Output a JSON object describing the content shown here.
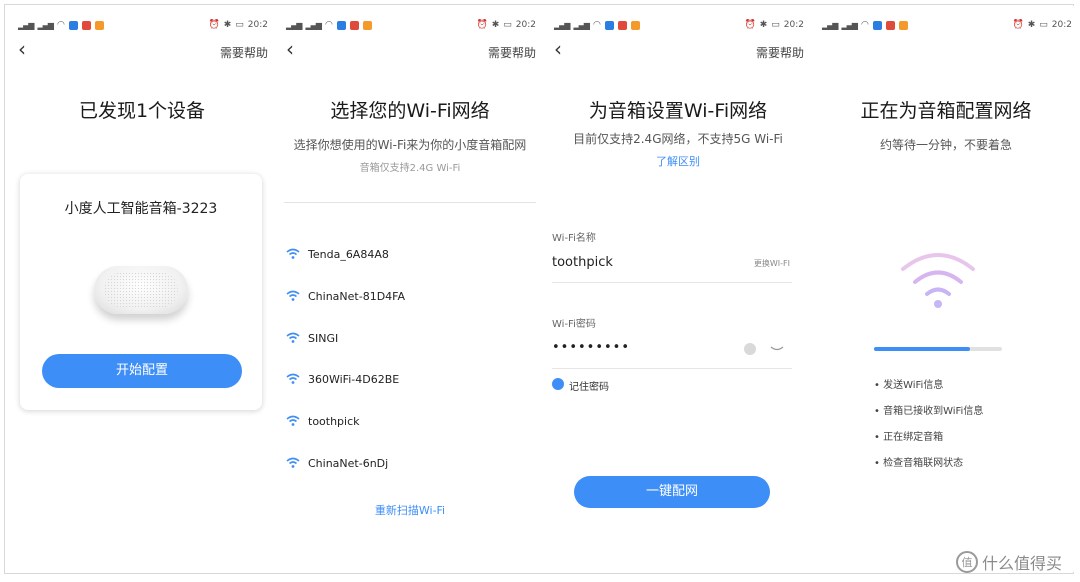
{
  "status_bar": {
    "time": "20:2",
    "left_icons": [
      "signal-icon",
      "signal-icon",
      "wifi-icon",
      "app-icon",
      "app-icon",
      "app-icon"
    ],
    "right_icons": [
      "alarm-icon",
      "bluetooth-icon",
      "battery-icon"
    ]
  },
  "colors": {
    "accent": "#3e8ef7",
    "divider": "#e3e3e3"
  },
  "panel1": {
    "help": "需要帮助",
    "title": "已发现1个设备",
    "device_name": "小度人工智能音箱-3223",
    "start_button": "开始配置"
  },
  "panel2": {
    "help": "需要帮助",
    "title": "选择您的Wi-Fi网络",
    "subtitle": "选择你想使用的Wi-Fi来为你的小度音箱配网",
    "note": "音箱仅支持2.4G Wi-Fi",
    "networks": [
      "Tenda_6A84A8",
      "ChinaNet-81D4FA",
      "SINGI",
      "360WiFi-4D62BE",
      "toothpick",
      "ChinaNet-6nDj"
    ],
    "rescan": "重新扫描Wi-Fi"
  },
  "panel3": {
    "help": "需要帮助",
    "title": "为音箱设置Wi-Fi网络",
    "subtitle": "目前仅支持2.4G网络，不支持5G Wi-Fi",
    "learn_link": "了解区别",
    "wifi_name_label": "Wi-Fi名称",
    "wifi_name_value": "toothpick",
    "change_wifi": "更换WI-FI",
    "password_label": "Wi-Fi密码",
    "password_value": "•••••••••",
    "remember_label": "记住密码",
    "connect_button": "一键配网"
  },
  "panel4": {
    "help": "",
    "title": "正在为音箱配置网络",
    "subtitle": "约等待一分钟，不要着急",
    "progress": 0.75,
    "steps": [
      "发送WiFi信息",
      "音箱已接收到WiFi信息",
      "正在绑定音箱",
      "检查音箱联网状态"
    ]
  },
  "watermark": {
    "text": "什么值得买",
    "logo": "值"
  }
}
